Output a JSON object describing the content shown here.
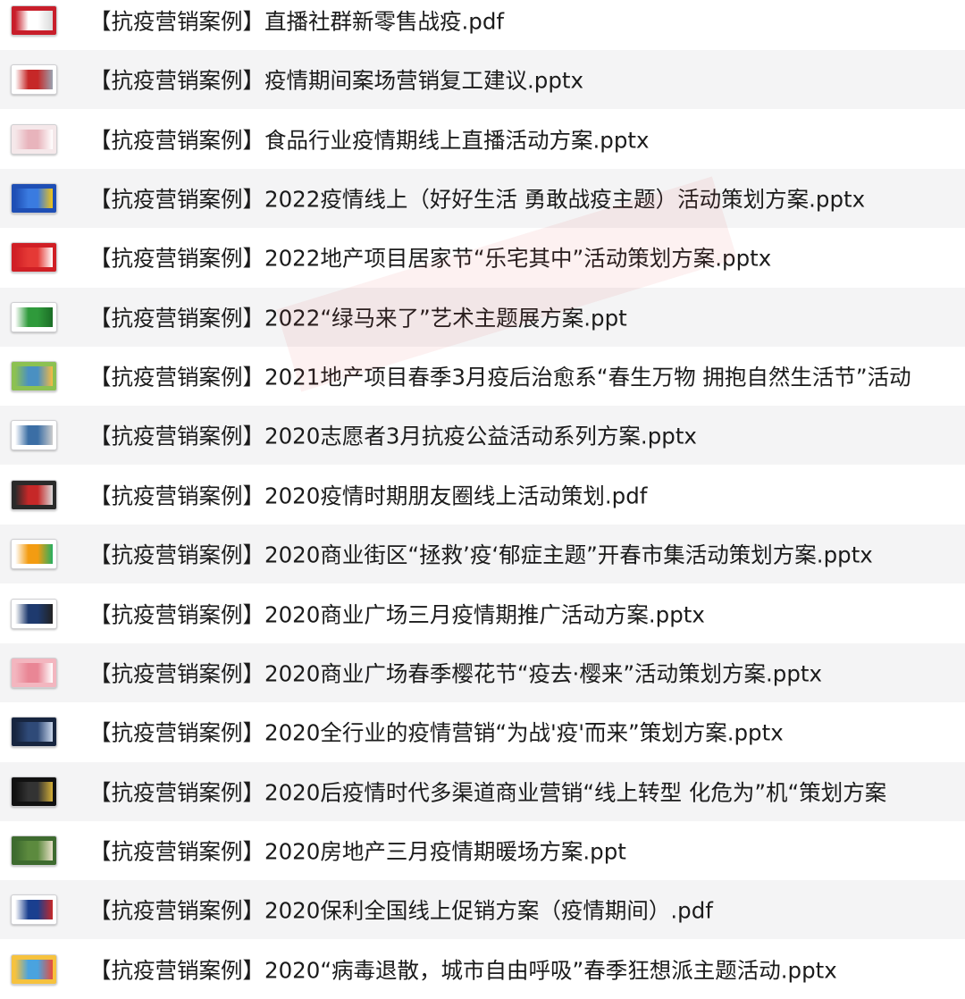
{
  "files": [
    {
      "name": "【抗疫营销案例】直播社群新零售战疫.pdf",
      "thumb": "red-title-doc-thumbnail",
      "colors": [
        "#c81e2a",
        "#ffffff",
        "#d9d9d9"
      ]
    },
    {
      "name": "【抗疫营销案例】疫情期间案场营销复工建议.pptx",
      "thumb": "red-banner-slide-thumbnail",
      "colors": [
        "#ffffff",
        "#c62828",
        "#9aa3b0"
      ]
    },
    {
      "name": "【抗疫营销案例】食品行业疫情期线上直播活动方案.pptx",
      "thumb": "pink-slide-thumbnail",
      "colors": [
        "#f5e8ea",
        "#e8b4bc",
        "#ffffff"
      ]
    },
    {
      "name": "【抗疫营销案例】2022疫情线上（好好生活 勇敢战疫主题）活动策划方案.pptx",
      "thumb": "blue-slide-thumbnail",
      "colors": [
        "#1f4fb5",
        "#3a7be0",
        "#f0c419"
      ]
    },
    {
      "name": "【抗疫营销案例】2022地产项目居家节“乐宅其中”活动策划方案.pptx",
      "thumb": "red-slide-thumbnail",
      "colors": [
        "#d01f25",
        "#e53935",
        "#ffffff"
      ]
    },
    {
      "name": "【抗疫营销案例】2022“绿马来了”艺术主题展方案.ppt",
      "thumb": "green-horse-slide-thumbnail",
      "colors": [
        "#ffffff",
        "#2f9a3b",
        "#1b6d26"
      ]
    },
    {
      "name": "【抗疫营销案例】2021地产项目春季3月疫后治愈系“春生万物 拥抱自然生活节”活动",
      "thumb": "spring-landscape-slide-thumbnail",
      "colors": [
        "#8cc152",
        "#4a90c2",
        "#f6bb42"
      ]
    },
    {
      "name": "【抗疫营销案例】2020志愿者3月抗疫公益活动系列方案.pptx",
      "thumb": "white-photo-slide-thumbnail",
      "colors": [
        "#ffffff",
        "#3b6ea5",
        "#cccccc"
      ]
    },
    {
      "name": "【抗疫营销案例】2020疫情时期朋友圈线上活动策划.pdf",
      "thumb": "dark-red-pdf-thumbnail",
      "colors": [
        "#2a2a2a",
        "#c62828",
        "#d9d9d9"
      ]
    },
    {
      "name": "【抗疫营销案例】2020商业街区“拯救’疫‘郁症主题”开春市集活动策划方案.pptx",
      "thumb": "colorful-market-slide-thumbnail",
      "colors": [
        "#ffffff",
        "#f39c12",
        "#27ae60"
      ]
    },
    {
      "name": "【抗疫营销案例】2020商业广场三月疫情期推广活动方案.pptx",
      "thumb": "sincere-slide-thumbnail",
      "colors": [
        "#ffffff",
        "#1e3a6e",
        "#222222"
      ]
    },
    {
      "name": "【抗疫营销案例】2020商业广场春季樱花节“疫去·樱来”活动策划方案.pptx",
      "thumb": "cherry-blossom-slide-thumbnail",
      "colors": [
        "#f3b6bf",
        "#e98695",
        "#ffffff"
      ]
    },
    {
      "name": "【抗疫营销案例】2020全行业的疫情营销“为战'疫'而来”策划方案.pptx",
      "thumb": "dark-blue-slide-thumbnail",
      "colors": [
        "#17253f",
        "#2f4a78",
        "#c9d6ea"
      ]
    },
    {
      "name": "【抗疫营销案例】2020后疫情时代多渠道商业营销“线上转型 化危为”机“策划方案",
      "thumb": "black-slide-thumbnail",
      "colors": [
        "#111111",
        "#333333",
        "#d4af37"
      ]
    },
    {
      "name": "【抗疫营销案例】2020房地产三月疫情期暖场方案.ppt",
      "thumb": "green-slide-thumbnail",
      "colors": [
        "#3e6b2f",
        "#5c8a3e",
        "#e8e0c8"
      ]
    },
    {
      "name": "【抗疫营销案例】2020保利全国线上促销方案（疫情期间）.pdf",
      "thumb": "poly-pdf-thumbnail",
      "colors": [
        "#ffffff",
        "#1a3f8f",
        "#c62828"
      ]
    },
    {
      "name": "【抗疫营销案例】2020“病毒退散，城市自由呼吸”春季狂想派主题活动.pptx",
      "thumb": "colorful-city-slide-thumbnail",
      "colors": [
        "#f6c23e",
        "#4aa3df",
        "#e74c3c"
      ]
    }
  ]
}
